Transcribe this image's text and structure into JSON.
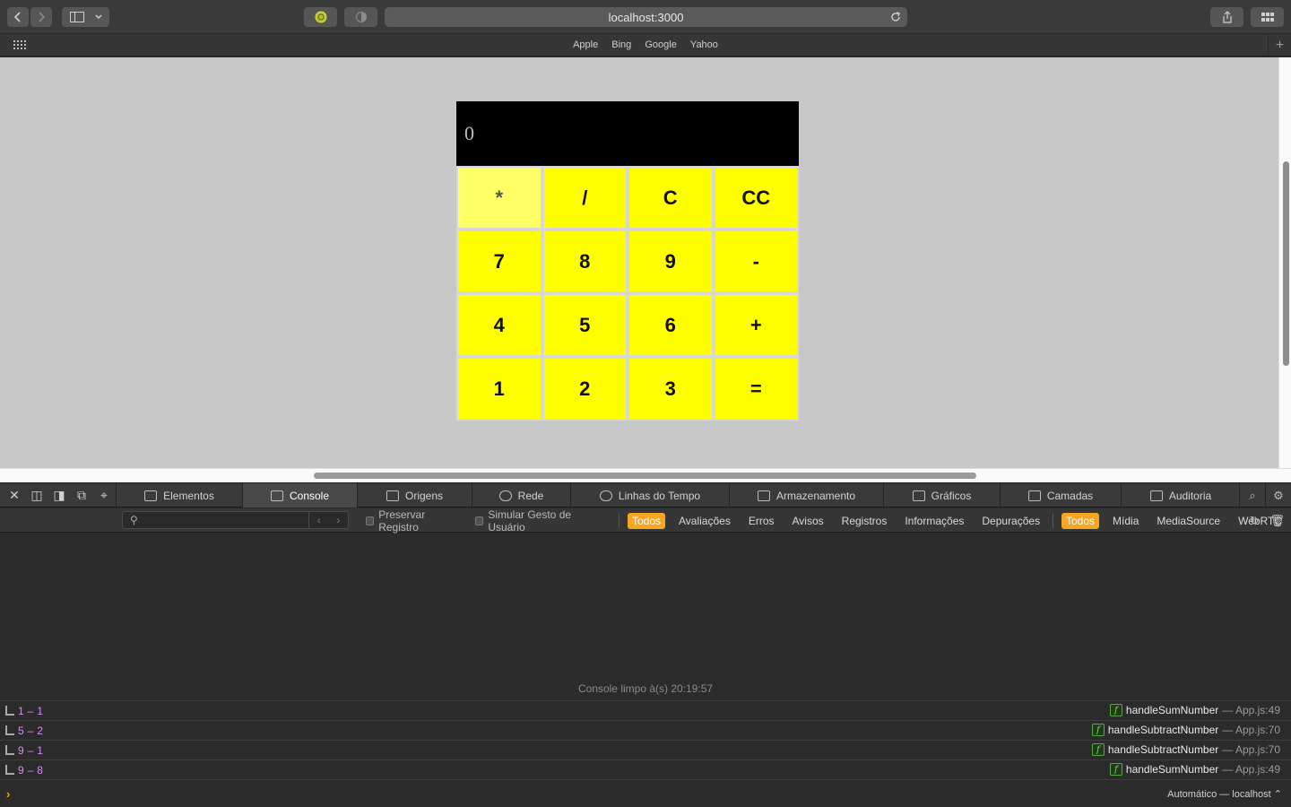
{
  "browser": {
    "url": "localhost:3000",
    "favorites": [
      "Apple",
      "Bing",
      "Google",
      "Yahoo"
    ]
  },
  "calculator": {
    "display": "0",
    "keys": [
      "*",
      "/",
      "C",
      "CC",
      "7",
      "8",
      "9",
      "-",
      "4",
      "5",
      "6",
      "+",
      "1",
      "2",
      "3",
      "="
    ],
    "active_key": "*",
    "colors": {
      "key": "#ffff00",
      "display": "#000000"
    }
  },
  "inspector": {
    "tabs": [
      "Elementos",
      "Console",
      "Origens",
      "Rede",
      "Linhas do Tempo",
      "Armazenamento",
      "Gráficos",
      "Camadas",
      "Auditoria"
    ],
    "selected_tab": "Console",
    "filter": {
      "preserve_log": "Preservar Registro",
      "simulate_gesture": "Simular Gesto de Usuário",
      "levels": [
        "Todos",
        "Avaliações",
        "Erros",
        "Avisos",
        "Registros",
        "Informações",
        "Depurações"
      ],
      "sources": [
        "Todos",
        "Mídia",
        "MediaSource",
        "WebRTC"
      ]
    },
    "console": {
      "cleared_message": "Console limpo à(s) 20:19:57",
      "logs": [
        {
          "message": "1 – 1",
          "function": "handleSumNumber",
          "location": "— App.js:49"
        },
        {
          "message": "5 – 2",
          "function": "handleSubtractNumber",
          "location": "— App.js:70"
        },
        {
          "message": "9 – 1",
          "function": "handleSubtractNumber",
          "location": "— App.js:70"
        },
        {
          "message": "9 – 8",
          "function": "handleSumNumber",
          "location": "— App.js:49"
        }
      ],
      "context": "Automático — localhost ⌃"
    }
  }
}
